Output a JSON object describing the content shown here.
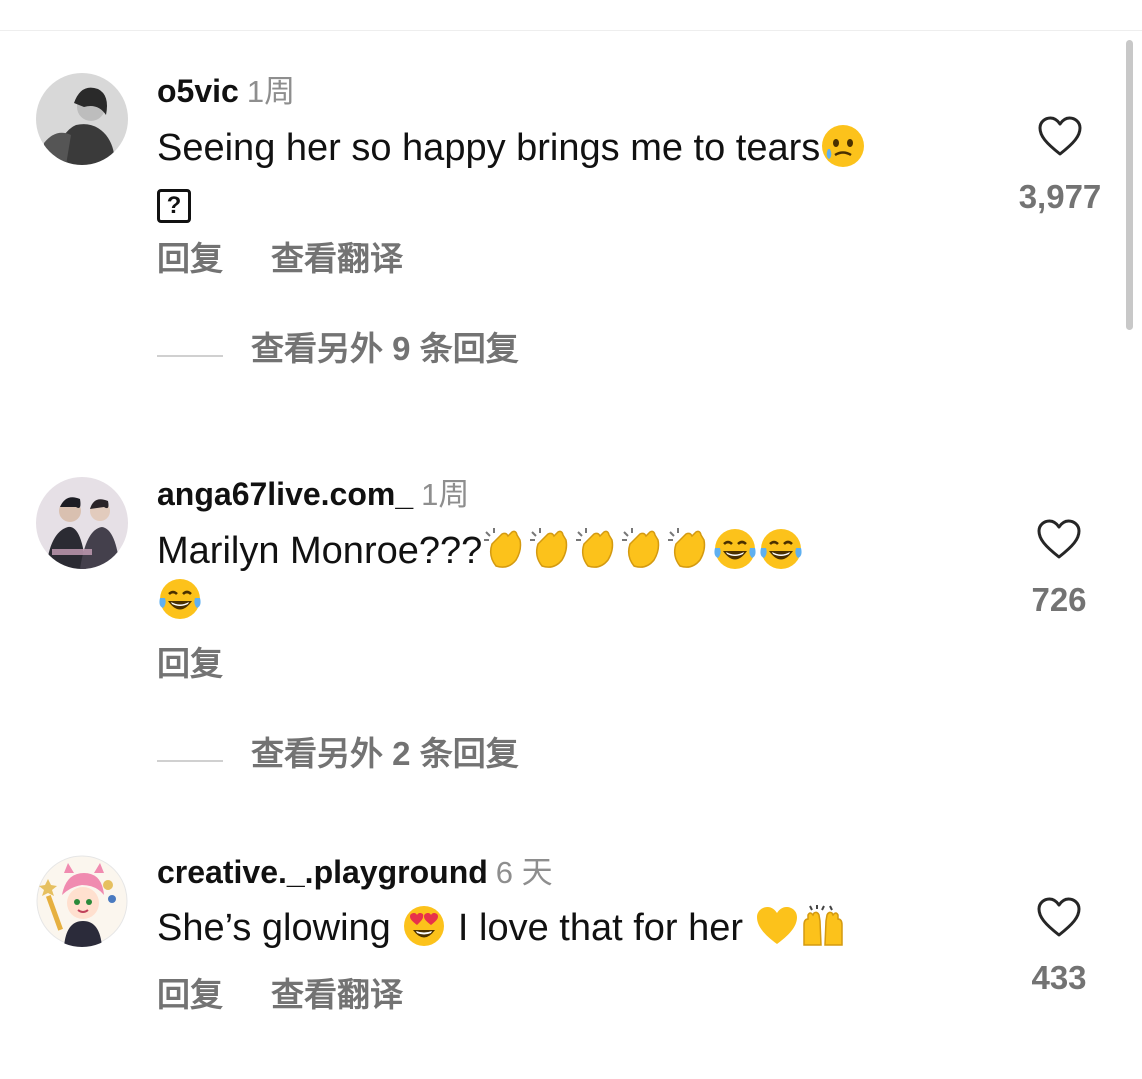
{
  "comments": [
    {
      "username": "o5vic",
      "time": "1周",
      "text": "Seeing her so happy brings me to tears",
      "emojis": [
        "holding-back-tears-emoji"
      ],
      "likes": "3,977",
      "actions": [
        "回复",
        "查看翻译"
      ],
      "more_replies": "查看另外 9 条回复"
    },
    {
      "username": "anga67live.com_",
      "time": "1周",
      "text": "Marilyn Monroe???",
      "emojis": [
        "clapping-hands-emoji",
        "clapping-hands-emoji",
        "clapping-hands-emoji",
        "clapping-hands-emoji",
        "clapping-hands-emoji",
        "tears-of-joy-emoji",
        "tears-of-joy-emoji",
        "tears-of-joy-emoji"
      ],
      "likes": "726",
      "actions": [
        "回复"
      ],
      "more_replies": "查看另外 2 条回复"
    },
    {
      "username": "creative._.playground",
      "time": "6 天",
      "text_before": "She’s glowing",
      "text_after": "I love that for her",
      "emojis": [
        "heart-eyes-emoji",
        "yellow-heart-emoji",
        "raising-hands-emoji"
      ],
      "likes": "433",
      "actions": [
        "回复",
        "查看翻译"
      ]
    }
  ],
  "colors": {
    "text": "#111111",
    "secondary": "#737373",
    "timestamp": "#8e8e8e",
    "emoji_yellow": "#fcc21b"
  }
}
